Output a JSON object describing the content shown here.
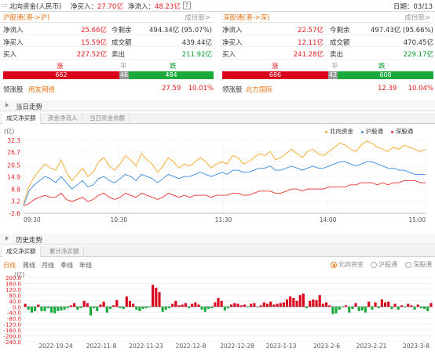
{
  "header": {
    "title": "北向资金(人民币)",
    "net_buy_label": "净买入：",
    "net_buy_value": "27.70亿",
    "net_inflow_label": "净流入：",
    "net_inflow_value": "48.23亿",
    "help": "?",
    "date_label": "日期：03/13"
  },
  "sh": {
    "title": "沪股通(港->沪)",
    "more": "成份股>",
    "rows": [
      {
        "l1": "净流入",
        "v1": "25.66亿",
        "l2": "今剩余",
        "v2": "494.34亿 (95.07%)"
      },
      {
        "l1": "净买入",
        "v1": "15.59亿",
        "l2": "成交额",
        "v2": "439.44亿"
      },
      {
        "l1": "买入",
        "v1": "227.52亿",
        "l2": "卖出",
        "v2": "211.92亿"
      }
    ],
    "up_label": "涨",
    "flat_label": "平",
    "down_label": "跌",
    "up": "662",
    "flat": "46",
    "down": "484",
    "leader_label": "领涨股",
    "leader": "用友网络",
    "leader_price": "27.59",
    "leader_pct": "10.01%"
  },
  "sz": {
    "title": "深股通(港->深)",
    "more": "成份股>",
    "rows": [
      {
        "l1": "净流入",
        "v1": "22.57亿",
        "l2": "今剩余",
        "v2": "497.43亿 (95.66%)"
      },
      {
        "l1": "净买入",
        "v1": "12.11亿",
        "l2": "成交额",
        "v2": "470.45亿"
      },
      {
        "l1": "买入",
        "v1": "241.28亿",
        "l2": "卖出",
        "v2": "229.17亿"
      }
    ],
    "up_label": "涨",
    "flat_label": "平",
    "down_label": "跌",
    "up": "686",
    "flat": "42",
    "down": "608",
    "leader_label": "领涨股",
    "leader": "北方国际",
    "leader_price": "12.39",
    "leader_pct": "10.04%"
  },
  "intraday": {
    "section": "当日走势",
    "tabs": [
      "成交净买额",
      "资金净流入",
      "当日资金余额"
    ],
    "unit": "(亿)",
    "legend": [
      "北向资金",
      "沪股通",
      "深股通"
    ]
  },
  "history": {
    "section": "历史走势",
    "tabs": [
      "成交净买额",
      "累计净买额"
    ],
    "periods": [
      "日线",
      "周线",
      "月线",
      "季线",
      "年线"
    ],
    "radios": [
      "北向资金",
      "沪股通",
      "深股通"
    ],
    "unit": "(亿)"
  },
  "colors": {
    "north": "#f5a623",
    "sh": "#3a87e0",
    "sz": "#e8302a",
    "up": "#d9001b",
    "down": "#1aaa3c",
    "accent": "#e8761a"
  },
  "chart_data": [
    {
      "type": "line",
      "title": "",
      "ylabel": "(亿)",
      "yticks": [
        32.3,
        26.7,
        20.5,
        14.9,
        8.8,
        3.2,
        -2.6
      ],
      "ylim": [
        -2.6,
        32.3
      ],
      "xticks": [
        "09:30",
        "10:30",
        "11:30",
        "14:00",
        "15:00"
      ],
      "series": [
        {
          "name": "北向资金",
          "color": "#f5a623",
          "values": [
            2,
            10,
            15,
            18,
            21,
            19,
            18,
            23,
            17,
            13,
            16,
            19,
            15,
            17,
            22,
            24,
            20,
            18,
            21,
            25,
            23,
            20,
            26,
            23,
            21,
            17,
            20,
            24,
            22,
            19,
            21,
            20,
            22,
            24,
            22,
            19,
            21,
            22,
            21,
            25,
            24,
            21,
            22,
            24,
            26,
            25,
            27,
            23,
            24,
            26,
            28,
            26,
            24,
            27,
            28,
            26,
            25,
            27,
            29,
            31,
            30,
            28,
            27,
            30,
            32,
            31,
            29,
            28,
            27,
            29,
            28,
            30,
            29,
            28,
            27,
            28
          ]
        },
        {
          "name": "沪股通",
          "color": "#3a87e0",
          "values": [
            1,
            8,
            11,
            13,
            15,
            14,
            12,
            15,
            12,
            9,
            11,
            13,
            10,
            11,
            14,
            15,
            13,
            12,
            14,
            16,
            15,
            13,
            16,
            15,
            14,
            12,
            14,
            16,
            15,
            14,
            15,
            15,
            16,
            17,
            16,
            15,
            16,
            17,
            16,
            18,
            18,
            17,
            17,
            18,
            19,
            19,
            20,
            18,
            18,
            19,
            20,
            19,
            18,
            19,
            20,
            19,
            19,
            20,
            21,
            22,
            22,
            21,
            20,
            21,
            22,
            22,
            21,
            20,
            19,
            19,
            18,
            18,
            17,
            16,
            16,
            16
          ]
        },
        {
          "name": "深股通",
          "color": "#e8302a",
          "values": [
            1,
            2,
            4,
            5,
            6,
            5,
            5,
            7,
            4,
            3,
            4,
            5,
            3,
            4,
            6,
            7,
            5,
            4,
            5,
            7,
            6,
            5,
            7,
            6,
            5,
            4,
            5,
            7,
            6,
            5,
            6,
            5,
            6,
            6,
            6,
            5,
            6,
            6,
            6,
            7,
            7,
            6,
            6,
            7,
            8,
            8,
            8,
            7,
            7,
            8,
            9,
            9,
            8,
            9,
            9,
            9,
            9,
            10,
            10,
            10,
            10,
            11,
            11,
            12,
            12,
            12,
            11,
            12,
            11,
            12,
            12,
            13,
            13,
            13,
            12,
            12
          ]
        }
      ]
    },
    {
      "type": "bar",
      "title": "",
      "ylabel": "(亿)",
      "yticks": [
        200,
        160,
        120,
        80,
        40,
        0,
        -40,
        -80,
        -120,
        -160,
        -200,
        -240
      ],
      "ylim": [
        -240,
        200
      ],
      "xticks": [
        "2022-10-24",
        "2022-11-8",
        "2022-11-23",
        "2022-12-8",
        "2022-12-28",
        "2023-1-13",
        "2023-2-6",
        "2023-2-21",
        "2023-3-8"
      ],
      "values": [
        20,
        -20,
        -40,
        -30,
        15,
        -30,
        -30,
        -10,
        -40,
        -45,
        -30,
        -25,
        -20,
        -10,
        10,
        25,
        -20,
        -10,
        40,
        25,
        -60,
        -10,
        -30,
        15,
        35,
        -40,
        -15,
        10,
        45,
        -10,
        -15,
        70,
        40,
        20,
        -20,
        -30,
        -15,
        -10,
        -5,
        150,
        130,
        100,
        -35,
        -20,
        -10,
        20,
        40,
        10,
        15,
        25,
        -10,
        20,
        30,
        15,
        -20,
        -35,
        -15,
        -10,
        30,
        60,
        40,
        -25,
        -10,
        15,
        25,
        20,
        10,
        15,
        -5,
        20,
        25,
        -5,
        10,
        30,
        20,
        35,
        15,
        20,
        25,
        30,
        50,
        70,
        60,
        40,
        80,
        90,
        -10,
        40,
        50,
        45,
        80,
        20,
        30,
        10,
        -50,
        -45,
        -20,
        -5,
        10,
        -40,
        -15,
        25,
        -30,
        -25,
        -40,
        35,
        -20,
        30,
        -10,
        50,
        30,
        35,
        -15,
        20,
        -20,
        10,
        -5,
        20,
        10,
        -20,
        15,
        -10,
        -15,
        -30,
        25
      ]
    }
  ]
}
